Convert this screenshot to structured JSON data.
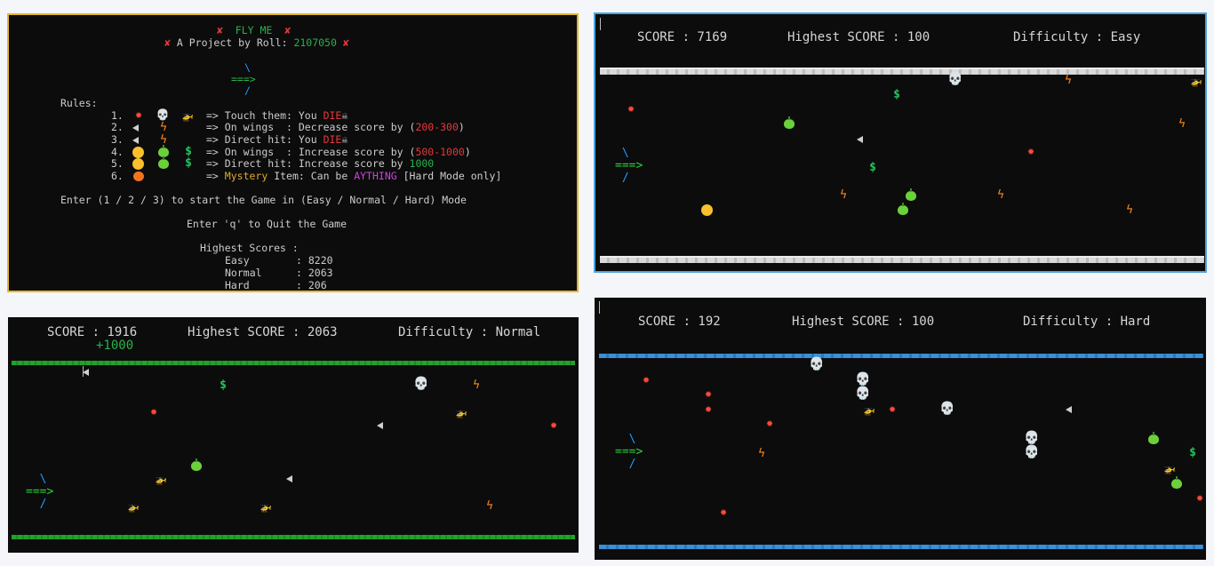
{
  "menu": {
    "title": "FLY ME",
    "subtitle_prefix": "A Project by Roll: ",
    "roll": "2107050",
    "logo_top": "\\",
    "logo_mid": "===>",
    "logo_bot": "/",
    "rules_label": "Rules:",
    "rules": [
      {
        "num": "1.",
        "arrow": "=>",
        "a": "Touch them: You ",
        "b": "DIE",
        "c": ""
      },
      {
        "num": "2.",
        "arrow": "=>",
        "a": "On wings  : Decrease score by (",
        "b": "200-300",
        "c": ")"
      },
      {
        "num": "3.",
        "arrow": "=>",
        "a": "Direct hit: You ",
        "b": "DIE",
        "c": ""
      },
      {
        "num": "4.",
        "arrow": "=>",
        "a": "On wings  : Increase score by (",
        "b": "500-1000",
        "c": ")"
      },
      {
        "num": "5.",
        "arrow": "=>",
        "a": "Direct hit: Increase score by ",
        "b": "1000",
        "c": ""
      },
      {
        "num": "6.",
        "arrow": "=>",
        "a": "Mystery",
        "b": " Item: Can be ",
        "c": "AYTHING",
        "d": " [Hard Mode only]"
      }
    ],
    "enter_mode": "Enter (1 / 2 / 3) to start the Game in (Easy / Normal / Hard) Mode",
    "quit": "Enter 'q' to Quit the Game",
    "highest_label": "Highest Scores :",
    "scores": [
      {
        "mode": "Easy",
        "sep": ":",
        "value": "8220"
      },
      {
        "mode": "Normal",
        "sep": ":",
        "value": "2063"
      },
      {
        "mode": "Hard",
        "sep": ":",
        "value": "206"
      }
    ]
  },
  "easy": {
    "score": "SCORE : 7169",
    "highest": "Highest SCORE : 100",
    "difficulty": "Difficulty : Easy"
  },
  "normal": {
    "score": "SCORE : 1916",
    "bonus": "+1000",
    "highest": "Highest SCORE : 2063",
    "difficulty": "Difficulty : Normal"
  },
  "hard": {
    "score": "SCORE : 192",
    "highest": "Highest SCORE : 100",
    "difficulty": "Difficulty : Hard"
  },
  "plane": {
    "top": "\\",
    "body": "===>",
    "bottom": "/"
  },
  "glyphs": {
    "explode": "✹",
    "bolt": "ϟ",
    "dollar": "$",
    "skull": "💀",
    "heli": "🚁",
    "cross": "✘",
    "skull_small": "☠"
  },
  "colors": {
    "bg": "#0c0c0c",
    "menu_border": "#e3b62b",
    "easy_border": "#4aa3df",
    "green": "#26b34a",
    "red": "#e5383b",
    "rail_green": "#22a22a",
    "rail_blue": "#3a8fd8"
  },
  "icons": {
    "explode": "explosion-icon",
    "bolt": "lightning-icon",
    "dollar": "dollar-icon",
    "skull": "skull-icon",
    "heli": "helicopter-icon",
    "tri": "arrowhead-icon",
    "coin": "coin-icon",
    "apple": "apple-icon",
    "mystery": "mystery-icon"
  }
}
